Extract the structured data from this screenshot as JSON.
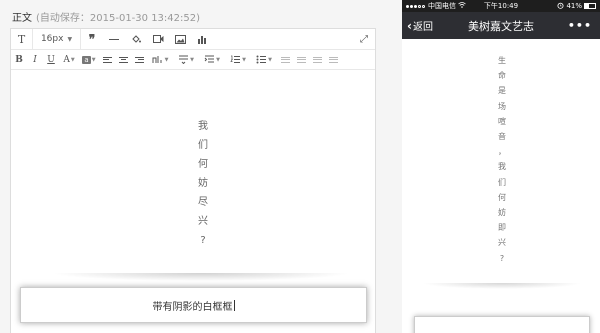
{
  "editor": {
    "title": "正文",
    "autosave": "(自动保存：2015-01-30 13:42:52)",
    "toolbar": {
      "font_size": "16px",
      "text_icon_glyph": "T",
      "quote_glyph": "❞",
      "expand_glyph": "⤢"
    },
    "format_toolbar": {
      "bold": "B",
      "italic": "I",
      "underline": "U",
      "strike": "A"
    },
    "vertical_text": [
      "我",
      "们",
      "何",
      "妨",
      "尽",
      "兴",
      "?"
    ],
    "shadow_box_text": "带有阴影的白框框"
  },
  "phone": {
    "status": {
      "carrier": "中国电信",
      "time": "下午10:49",
      "battery": "41%"
    },
    "nav": {
      "back_label": "返回",
      "title": "美树嘉文艺志",
      "more": "•••"
    },
    "vertical_text": [
      "生",
      "命",
      "是",
      "场",
      "喧",
      "音",
      "，",
      "我",
      "们",
      "何",
      "妨",
      "即",
      "兴",
      "?"
    ]
  },
  "colors": {
    "nav_bg": "#2d2e33",
    "status_bg": "#1e1e1e",
    "page_bg": "#f5f5f5"
  },
  "icons": [
    "text-style-icon",
    "quote-icon",
    "horizontal-rule-icon",
    "paint-bucket-icon",
    "video-icon",
    "image-icon",
    "bar-chart-icon",
    "expand-icon",
    "back-chevron-icon",
    "more-icon",
    "wifi-icon",
    "alarm-icon",
    "battery-icon"
  ]
}
